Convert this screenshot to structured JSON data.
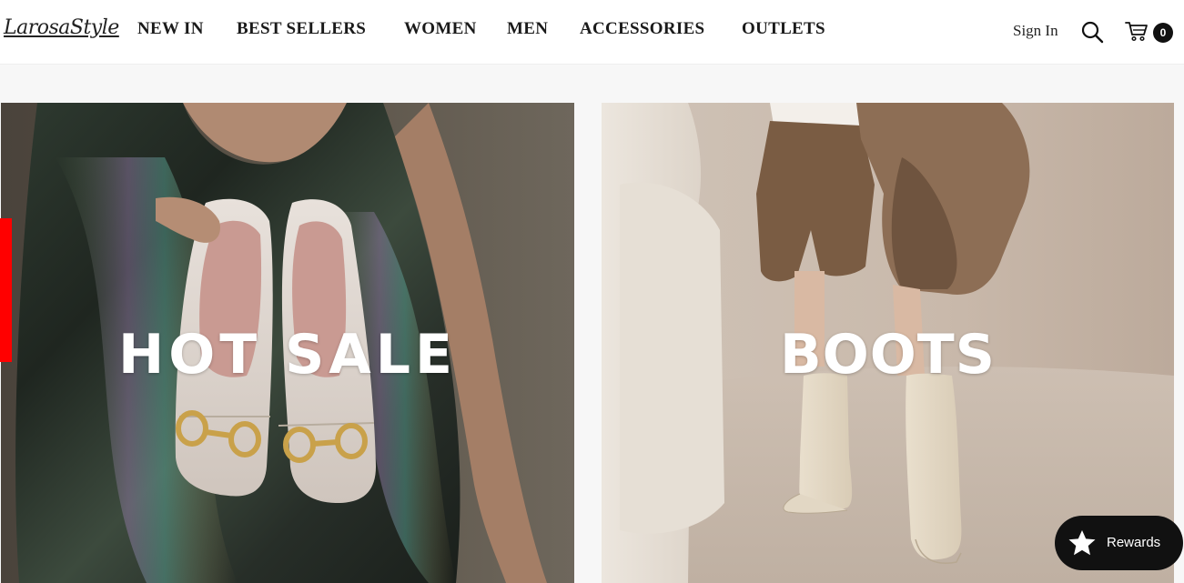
{
  "header": {
    "logo_text": "LarosaStyle",
    "nav": [
      {
        "label": "NEW IN"
      },
      {
        "label": "BEST SELLERS"
      },
      {
        "label": "WOMEN"
      },
      {
        "label": "MEN"
      },
      {
        "label": "ACCESSORIES"
      },
      {
        "label": "OUTLETS"
      }
    ],
    "sign_in_label": "Sign In",
    "search_icon": "search-icon",
    "cart_icon": "cart-icon",
    "cart_count": "0"
  },
  "banners": [
    {
      "title": "HOT SALE",
      "image": "woman-holding-loafers-photo"
    },
    {
      "title": "BOOTS",
      "image": "woman-wearing-cream-boots-photo"
    }
  ],
  "rewards": {
    "label": "Rewards",
    "icon": "star-icon"
  },
  "colors": {
    "accent_red": "#ff0000",
    "header_bg": "#ffffff",
    "page_bg": "#f7f7f7",
    "rewards_bg": "#111111"
  }
}
